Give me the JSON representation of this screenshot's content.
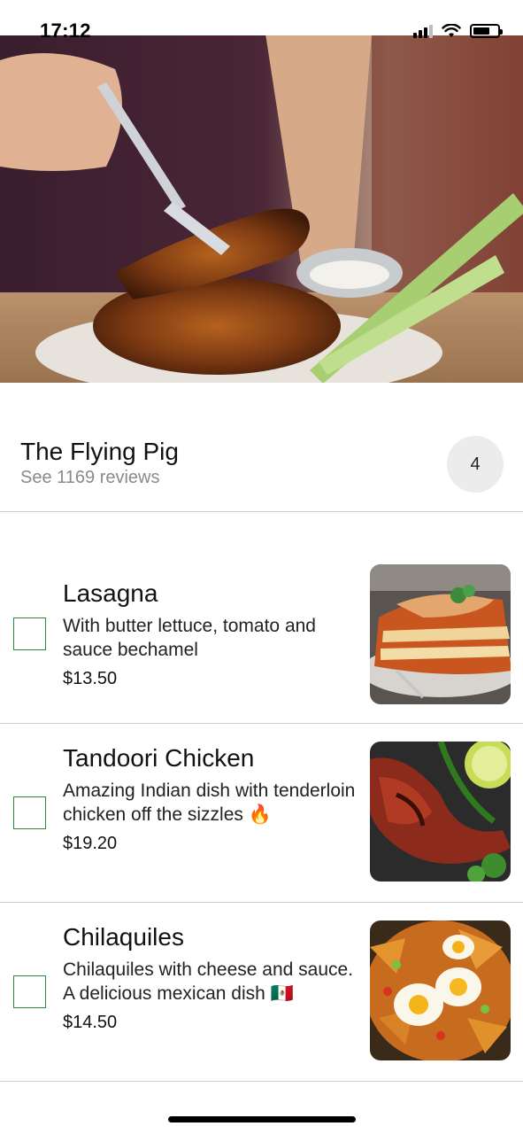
{
  "status_bar": {
    "time": "17:12",
    "icons": [
      "signal-icon",
      "wifi-icon",
      "battery-icon"
    ]
  },
  "hero": {
    "image": "chicken-wings-photo"
  },
  "restaurant": {
    "name": "The Flying Pig",
    "reviews_label": "See 1169 reviews",
    "cart_count": "4"
  },
  "menu": {
    "items": [
      {
        "name": "Lasagna",
        "description": "With butter lettuce, tomato and sauce bechamel",
        "price": "$13.50",
        "checked": false,
        "image": "lasagna-photo"
      },
      {
        "name": "Tandoori Chicken",
        "description": "Amazing Indian dish with tenderloin chicken off the sizzles 🔥",
        "price": "$19.20",
        "checked": false,
        "image": "tandoori-chicken-photo"
      },
      {
        "name": "Chilaquiles",
        "description": "Chilaquiles with cheese and sauce. A delicious mexican dish 🇲🇽",
        "price": "$14.50",
        "checked": false,
        "image": "chilaquiles-photo"
      }
    ]
  },
  "colors": {
    "checkbox_border": "#2e8b3a",
    "divider": "#cfcfcf",
    "secondary_text": "#8a8a8a",
    "badge_background": "#ececec"
  }
}
